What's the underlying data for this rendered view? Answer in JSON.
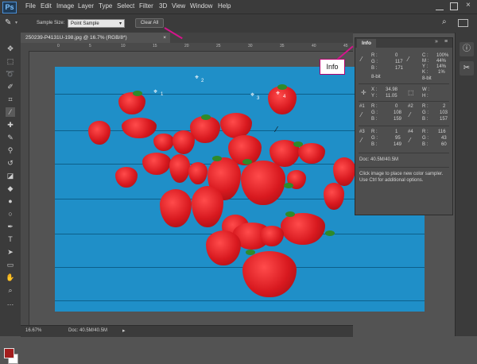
{
  "app": {
    "logo": "Ps"
  },
  "menu": [
    "File",
    "Edit",
    "Image",
    "Layer",
    "Type",
    "Select",
    "Filter",
    "3D",
    "View",
    "Window",
    "Help"
  ],
  "options": {
    "sample_size_label": "Sample Size:",
    "sample_size_value": "Point Sample",
    "clear_all_label": "Clear All"
  },
  "document": {
    "tab_title": "250239-P4131U-198.jpg @ 16.7% (RGB/8*)",
    "tab_close": "×",
    "zoom": "16.67%",
    "doc_size": "Doc: 40.5M/40.5M"
  },
  "ruler": {
    "ticks": [
      "0",
      "5",
      "10",
      "15",
      "20",
      "25",
      "30",
      "35",
      "40",
      "45"
    ]
  },
  "samplers": [
    "1",
    "2",
    "3",
    "4"
  ],
  "info_panel": {
    "tab_label": "Info",
    "rgb": {
      "r_label": "R :",
      "g_label": "G :",
      "b_label": "B :",
      "r": "0",
      "g": "117",
      "b": "171",
      "bit": "8-bit"
    },
    "cmyk": {
      "c_label": "C :",
      "m_label": "M :",
      "y_label": "Y :",
      "k_label": "K :",
      "c": "100%",
      "m": "44%",
      "y": "14%",
      "k": "1%",
      "bit": "8-bit"
    },
    "xy": {
      "x_label": "X :",
      "y_label": "Y :",
      "x": "34.98",
      "y": "11.05"
    },
    "wh": {
      "w_label": "W :",
      "h_label": "H :"
    },
    "samplers": [
      {
        "id": "#1",
        "r": "0",
        "g": "108",
        "b": "159"
      },
      {
        "id": "#2",
        "r": "2",
        "g": "103",
        "b": "157"
      },
      {
        "id": "#3",
        "r": "1",
        "g": "95",
        "b": "149"
      },
      {
        "id": "#4",
        "r": "116",
        "g": "43",
        "b": "60"
      }
    ],
    "doc": "Doc: 40.5M/40.5M",
    "hint_line1": "Click image to place new color sampler.",
    "hint_line2": "Use Ctrl for additional options."
  },
  "callout": {
    "label": "Info"
  },
  "colors": {
    "foreground": "#a31d1d",
    "background": "#ffffff",
    "accent": "#d4148c"
  }
}
